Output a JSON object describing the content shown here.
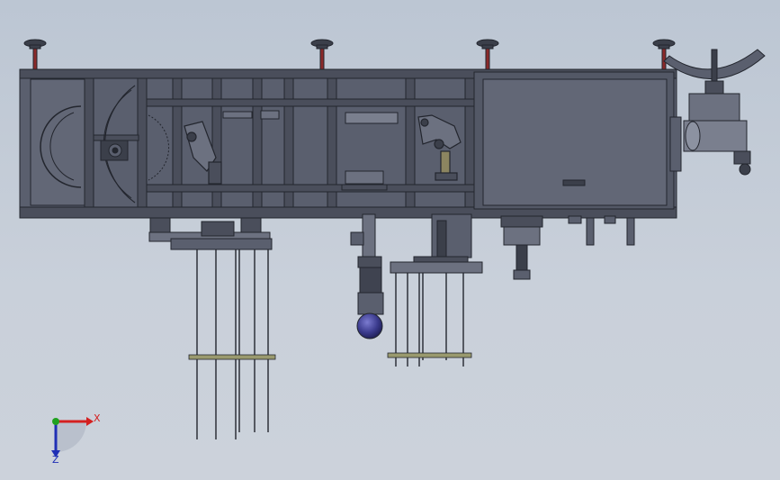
{
  "viewport": {
    "background_top": "#bcc6d3",
    "background_bottom": "#ccd2db"
  },
  "colors": {
    "frame_fill": "#5a5f6e",
    "frame_dark": "#3b3f4a",
    "frame_stroke": "#23262e",
    "panel_fill": "#626776",
    "leveling_post": "#8b2a2a",
    "probe_sphere": "#3a3a8c",
    "rod_band": "#9a9a6e",
    "axis_x": "#d42020",
    "axis_y": "#1fa11f",
    "axis_z": "#1f2fb5"
  },
  "triad": {
    "x_label": "X",
    "z_label": "Z"
  }
}
